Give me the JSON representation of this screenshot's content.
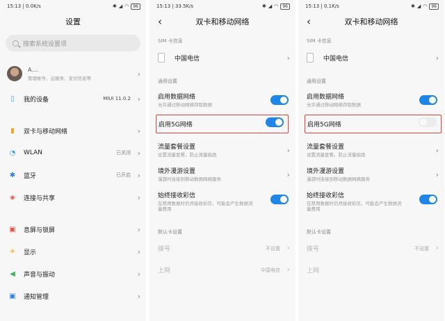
{
  "status": {
    "p1": {
      "time": "15:13",
      "speed": "0.0K/s",
      "battery": "96"
    },
    "p2": {
      "time": "15:13",
      "speed": "33.5K/s",
      "battery": "96"
    },
    "p3": {
      "time": "15:13",
      "speed": "0.1K/s",
      "battery": "96"
    }
  },
  "settings": {
    "title": "设置",
    "search_placeholder": "搜索系统设置项",
    "account": {
      "name": "A.... ",
      "subtitle": "管理帐号、云服务、支付信息等"
    },
    "device": {
      "label": "我的设备",
      "value": "MIUI 11.0.2"
    },
    "network_items": [
      {
        "label": "双卡与移动网络",
        "value": ""
      },
      {
        "label": "WLAN",
        "value": "已关闭"
      },
      {
        "label": "蓝牙",
        "value": "已开启"
      },
      {
        "label": "连接与共享",
        "value": ""
      }
    ],
    "system_items": [
      {
        "label": "息屏与锁屏"
      },
      {
        "label": "显示"
      },
      {
        "label": "声音与振动"
      },
      {
        "label": "通知管理"
      }
    ]
  },
  "dual": {
    "title": "双卡和移动网络",
    "sim_section": "SIM 卡信息",
    "sim_name": "中国电信",
    "general_section": "通用设置",
    "data": {
      "label": "启用数据网络",
      "desc": "允许通过移动网络存取数据"
    },
    "g5": {
      "label": "启用5G网络"
    },
    "plan": {
      "label": "流量套餐设置",
      "desc": "设置流量套餐，防止流量偷跑"
    },
    "roaming": {
      "label": "境外漫游设置",
      "desc": "漫游时连接到移动数据网络服务"
    },
    "mms": {
      "label": "始终接收彩信",
      "desc": "在禁用数据时仍然接收彩信，可能会产生数据流量费用"
    },
    "default_section": "默认卡设置",
    "dial": {
      "label": "拨号",
      "value": "不设置"
    },
    "internet": {
      "label": "上网",
      "value": "中国电信"
    }
  },
  "toggles": {
    "p2_5g": true,
    "p3_5g": false
  },
  "colors": {
    "accent": "#1f85e6",
    "highlight": "#e0443e"
  }
}
